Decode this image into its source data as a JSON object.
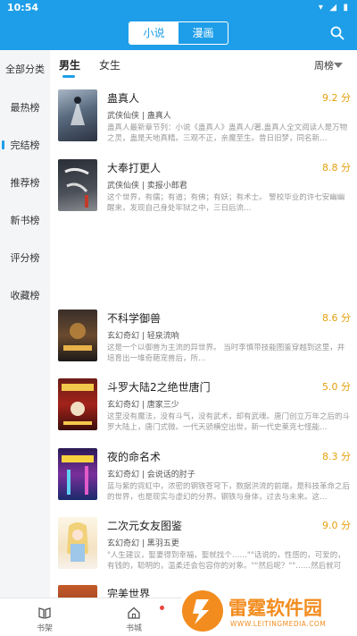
{
  "status_bar": {
    "time": "10:54",
    "system_icons": "▾ ◢ ▮"
  },
  "header": {
    "tabs": [
      {
        "label": "小说",
        "active": true
      },
      {
        "label": "漫画",
        "active": false
      }
    ],
    "search_icon": "search-icon"
  },
  "sidebar": {
    "items": [
      {
        "label": "全部分类",
        "active": false
      },
      {
        "label": "最热榜",
        "active": false
      },
      {
        "label": "完结榜",
        "active": true
      },
      {
        "label": "推荐榜",
        "active": false
      },
      {
        "label": "新书榜",
        "active": false
      },
      {
        "label": "评分榜",
        "active": false
      },
      {
        "label": "收藏榜",
        "active": false
      }
    ]
  },
  "filters": {
    "genders": [
      {
        "label": "男生",
        "active": true
      },
      {
        "label": "女生",
        "active": false
      }
    ],
    "sort_label": "周榜"
  },
  "books": [
    {
      "title": "蛊真人",
      "score": "9.2 分",
      "genre": "武侠仙侠",
      "author": "蛊真人",
      "desc": "蛊真人最新章节列：小说《蛊真人》蛊真人/著,蛊真人全文阅读人是万物之灵，蛊是天地真精。三观不正，亲魔至生。昔日旧梦，同名新…"
    },
    {
      "title": "大奉打更人",
      "score": "8.8 分",
      "genre": "武侠仙侠",
      "author": "卖报小郎君",
      "desc": "这个世界，有儒；有道；有佛；有妖；有术士。 警校毕业的许七安幽幽醒来，发现自己身处牢狱之中，三日后流…"
    },
    {
      "title": "不科学御兽",
      "score": "8.6 分",
      "genre": "玄幻奇幻",
      "author": "轻泉流响",
      "desc": "这是一个以御兽为主流的异世界。 当时李慎带技能图鉴穿越到这里，并培育出一堆奇葩宠兽后，所…"
    },
    {
      "title": "斗罗大陆2之绝世唐门",
      "score": "5.0 分",
      "genre": "玄幻奇幻",
      "author": "唐家三少",
      "desc": "这里没有魔法，没有斗气，没有武术，却有武魂。唐门创立万年之后的斗罗大陆上，唐门式微。一代天骄横空出世，新一代史莱克七怪能…"
    },
    {
      "title": "夜的命名术",
      "score": "8.3 分",
      "genre": "玄幻奇幻",
      "author": "会说话的肘子",
      "desc": "蓝与紫的霓虹中，浓密的钢铁苍穹下，数据洪流的前端，是科技革命之后的世界，也是现实与虚幻的分界。钢铁与身体，过去与未来。这…"
    },
    {
      "title": "二次元女友图鉴",
      "score": "9.0 分",
      "genre": "玄幻奇幻",
      "author": "黑羽五更",
      "desc": "\"人生建议，娶妻得到幸福，娶就找个……\"\"话说的，性感的，可爱的，有钱的，聪明的，温柔还会包容你的对象。\"\"然后呢？\"\"……然后就可以…"
    },
    {
      "title": "完美世界",
      "score": "",
      "genre": "",
      "author": "",
      "desc": ""
    }
  ],
  "bottom_nav": [
    {
      "label": "书架"
    },
    {
      "label": "书城"
    }
  ],
  "watermark": {
    "text": "雷霆软件园",
    "url": "WWW.LEITINGMEDIA.COM"
  },
  "colors": {
    "accent": "#1e9ee8",
    "score": "#e5a10f",
    "watermark": "#f28c1e"
  }
}
